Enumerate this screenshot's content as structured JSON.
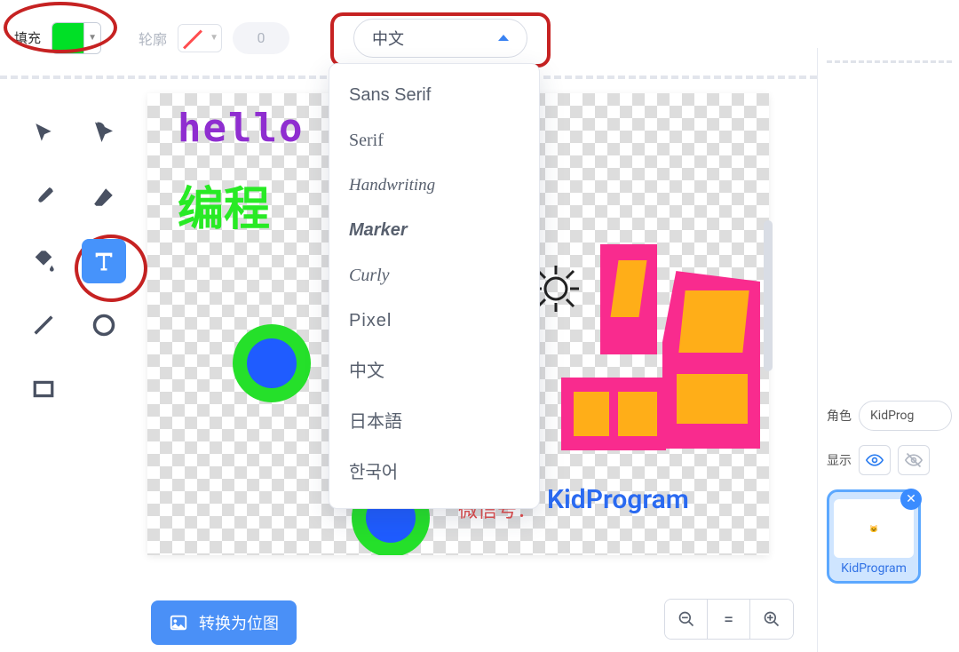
{
  "toolbar": {
    "fill_label": "填充",
    "fill_color": "#00e026",
    "outline_label": "轮廓",
    "width_value": "0",
    "font_current": "中文"
  },
  "font_options": [
    {
      "label": "Sans Serif",
      "cls": "fi-sans"
    },
    {
      "label": "Serif",
      "cls": "fi-serif"
    },
    {
      "label": "Handwriting",
      "cls": "fi-hand"
    },
    {
      "label": "Marker",
      "cls": "fi-marker"
    },
    {
      "label": "Curly",
      "cls": "fi-curly"
    },
    {
      "label": "Pixel",
      "cls": "fi-pixel"
    },
    {
      "label": "中文",
      "cls": "fi-cjk"
    },
    {
      "label": "日本語",
      "cls": "fi-cjk"
    },
    {
      "label": "한국어",
      "cls": "fi-cjk"
    }
  ],
  "canvas": {
    "text_hello": "hello",
    "text_program": "编程",
    "text_kidprogram": "KidProgram",
    "text_redprefix": "微信号："
  },
  "buttons": {
    "convert_bitmap": "转换为位图"
  },
  "right_panel": {
    "sprite_label": "角色",
    "sprite_name": "KidProg",
    "show_label": "显示",
    "thumb_caption": "KidProgram"
  },
  "tool_names": [
    "select",
    "reshape",
    "brush",
    "eraser",
    "fill",
    "text",
    "line",
    "circle",
    "rect"
  ]
}
